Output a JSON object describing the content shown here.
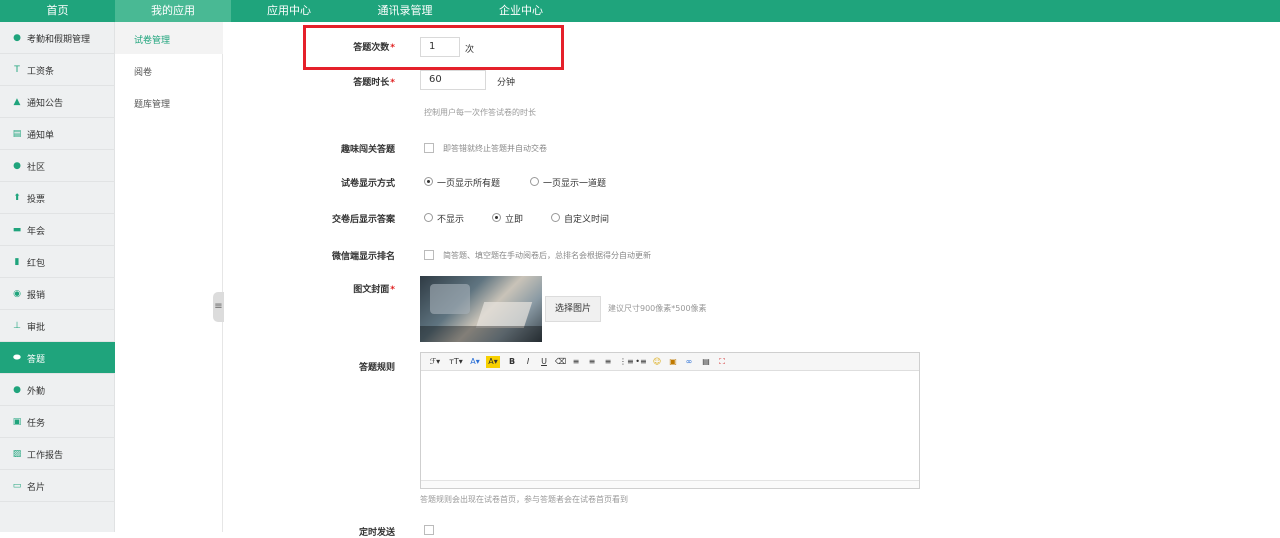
{
  "topnav": {
    "items": [
      "首页",
      "我的应用",
      "应用中心",
      "通讯录管理",
      "企业中心"
    ],
    "active_index": 1,
    "color": "#1fa47c"
  },
  "sidebar": {
    "items": [
      {
        "label": "考勤和假期管理",
        "icon": "person-icon"
      },
      {
        "label": "工资条",
        "icon": "salary-icon"
      },
      {
        "label": "通知公告",
        "icon": "bell-icon"
      },
      {
        "label": "通知单",
        "icon": "notice-icon"
      },
      {
        "label": "社区",
        "icon": "chat-icon"
      },
      {
        "label": "投票",
        "icon": "vote-icon"
      },
      {
        "label": "年会",
        "icon": "party-icon"
      },
      {
        "label": "红包",
        "icon": "red-packet-icon"
      },
      {
        "label": "报销",
        "icon": "money-icon"
      },
      {
        "label": "审批",
        "icon": "stamp-icon"
      },
      {
        "label": "答题",
        "icon": "quiz-icon"
      },
      {
        "label": "外勤",
        "icon": "location-icon"
      },
      {
        "label": "任务",
        "icon": "task-icon"
      },
      {
        "label": "工作报告",
        "icon": "report-icon"
      },
      {
        "label": "名片",
        "icon": "card-icon"
      }
    ],
    "active_label": "答题"
  },
  "subnav": {
    "items": [
      "试卷管理",
      "阅卷",
      "题库管理"
    ],
    "active_index": 0
  },
  "form": {
    "attempts": {
      "label": "答题次数",
      "required": "*",
      "value": "1",
      "unit": "次"
    },
    "duration": {
      "label": "答题时长",
      "required": "*",
      "value": "60",
      "unit": "分钟",
      "hint": "控制用户每一次作答试卷的时长"
    },
    "fun_pass": {
      "label": "趣味闯关答题",
      "checked": false,
      "text": "即答错就终止答题并自动交卷"
    },
    "display_mode": {
      "label": "试卷显示方式",
      "options": [
        "一页显示所有题",
        "一页显示一道题"
      ],
      "selected": "一页显示所有题"
    },
    "show_answer": {
      "label": "交卷后显示答案",
      "options": [
        "不显示",
        "立即",
        "自定义时间"
      ],
      "selected": "立即"
    },
    "wechat_rank": {
      "label": "微信端显示排名",
      "checked": false,
      "text": "简答题、填空题在手动阅卷后，总排名会根据得分自动更新"
    },
    "cover": {
      "label": "图文封面",
      "required": "*",
      "button": "选择图片",
      "hint": "建议尺寸900像素*500像素"
    },
    "rules": {
      "label": "答题规则",
      "hint": "答题规则会出现在试卷首页，参与答题者会在试卷首页看到"
    },
    "timed_send": {
      "label": "定时发送",
      "checked": false
    }
  },
  "editor_toolbar": [
    {
      "glyph": "ℱ▾",
      "icon": "font-family-icon"
    },
    {
      "glyph": "тT▾",
      "icon": "font-size-icon"
    },
    {
      "glyph": "A▾",
      "icon": "font-color-icon"
    },
    {
      "glyph": "A▾",
      "icon": "highlight-color-icon"
    },
    {
      "glyph": "B",
      "icon": "bold-icon"
    },
    {
      "glyph": "I",
      "icon": "italic-icon"
    },
    {
      "glyph": "U",
      "icon": "underline-icon"
    },
    {
      "glyph": "⌫",
      "icon": "clear-format-icon"
    },
    {
      "glyph": "≡",
      "icon": "align-left-icon"
    },
    {
      "glyph": "≡",
      "icon": "align-center-icon"
    },
    {
      "glyph": "≡",
      "icon": "align-right-icon"
    },
    {
      "glyph": "⋮≡",
      "icon": "ordered-list-icon"
    },
    {
      "glyph": "•≡",
      "icon": "unordered-list-icon"
    },
    {
      "glyph": "☺",
      "icon": "emoji-icon"
    },
    {
      "glyph": "▣",
      "icon": "image-icon"
    },
    {
      "glyph": "∞",
      "icon": "link-icon"
    },
    {
      "glyph": "▤",
      "icon": "paste-icon"
    },
    {
      "glyph": "⛶",
      "icon": "fullscreen-icon"
    }
  ]
}
